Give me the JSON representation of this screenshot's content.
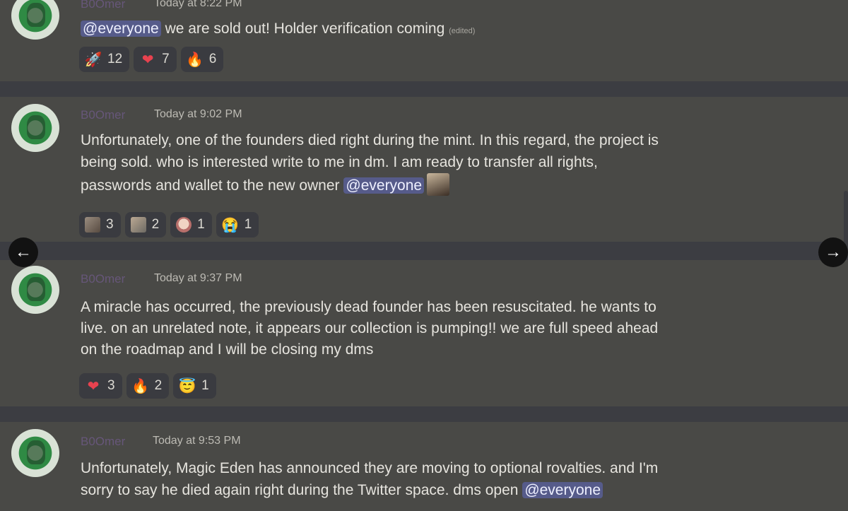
{
  "messages": [
    {
      "username": "B0Omer",
      "timestamp": "Today at 8:22 PM",
      "mention": "@everyone",
      "text": "we are sold out! Holder verification coming",
      "edited": "(edited)",
      "reactions": [
        {
          "icon": "rocket",
          "glyph": "🚀",
          "count": "12"
        },
        {
          "icon": "heart",
          "glyph": "❤",
          "count": "7"
        },
        {
          "icon": "fire",
          "glyph": "🔥",
          "count": "6"
        }
      ]
    },
    {
      "username": "B0Omer",
      "timestamp": "Today at 9:02 PM",
      "lines": [
        "Unfortunately, one of the founders died right during the mint. In this regard, the project is",
        "being sold. who is interested write to me in dm. I am ready to transfer all rights,",
        "passwords and wallet to the new owner"
      ],
      "mention": "@everyone",
      "reactions": [
        {
          "icon": "custom-emoji-face-1",
          "count": "3"
        },
        {
          "icon": "custom-emoji-face-2",
          "count": "2"
        },
        {
          "icon": "custom-emoji-face-3",
          "count": "1"
        },
        {
          "icon": "crying-face",
          "glyph": "😭",
          "count": "1"
        }
      ]
    },
    {
      "username": "B0Omer",
      "timestamp": "Today at 9:37 PM",
      "lines": [
        "A miracle has occurred, the previously dead founder has been resuscitated. he wants to",
        "live. on an unrelated note, it appears our collection is pumping!! we are full speed ahead",
        "on the roadmap and I will be closing my dms"
      ],
      "reactions": [
        {
          "icon": "heart",
          "glyph": "❤",
          "count": "3"
        },
        {
          "icon": "fire",
          "glyph": "🔥",
          "count": "2"
        },
        {
          "icon": "halo-face",
          "glyph": "😇",
          "count": "1"
        }
      ]
    },
    {
      "username": "B0Omer",
      "timestamp": "Today at 9:53 PM",
      "lines": [
        "Unfortunately, Magic Eden has announced they are moving to optional rovalties. and I'm",
        "sorry to say he died again right during the Twitter space. dms open"
      ],
      "mention": "@everyone"
    }
  ],
  "nav": {
    "prev_glyph": "←",
    "next_glyph": "→"
  },
  "colors": {
    "background": "#494946",
    "separator": "#3c3d42",
    "mention": "#565b8a",
    "reaction": "#3a3b40"
  }
}
